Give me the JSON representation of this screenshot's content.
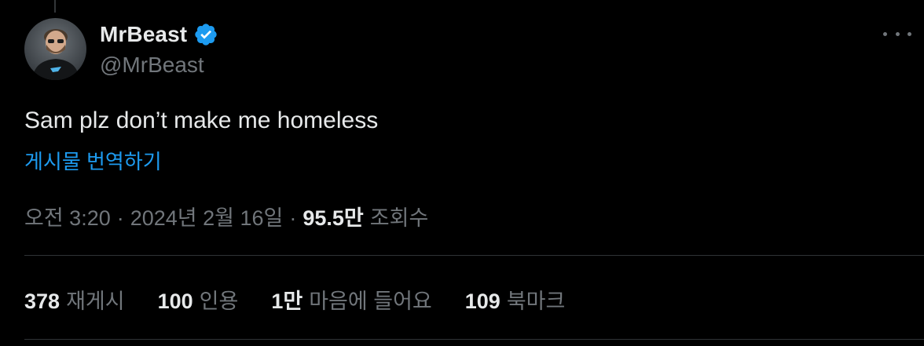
{
  "colors": {
    "background": "#000000",
    "text_primary": "#e7e9ea",
    "text_secondary": "#71767b",
    "link": "#1d9bf0",
    "verified_badge": "#1d9bf0",
    "divider": "#2f3336"
  },
  "author": {
    "display_name": "MrBeast",
    "handle": "@MrBeast",
    "verified_icon": "verified-badge-icon",
    "avatar_icon": "avatar-photo"
  },
  "tweet": {
    "text": "Sam plz don’t make me homeless",
    "translate_label": "게시물 번역하기"
  },
  "meta": {
    "time": "오전 3:20",
    "separator": "·",
    "date": "2024년 2월 16일",
    "views_count": "95.5만",
    "views_label": "조회수"
  },
  "stats": [
    {
      "count": "378",
      "label": "재게시"
    },
    {
      "count": "100",
      "label": "인용"
    },
    {
      "count": "1만",
      "label": "마음에 들어요"
    },
    {
      "count": "109",
      "label": "북마크"
    }
  ],
  "more_icon": "more-options-icon"
}
